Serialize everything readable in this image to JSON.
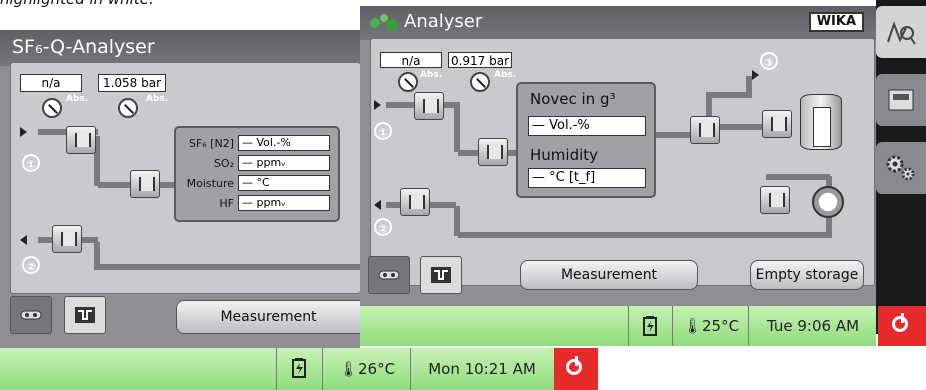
{
  "caption": "highlighted in white.",
  "back_window": {
    "title": "SF₆-Q-Analyser",
    "abs_label": "Abs.",
    "gauge1_value": "n/a",
    "gauge2_value": "1.058 bar",
    "marker1": "①",
    "marker2": "②",
    "readings": [
      {
        "label": "SF₆ [N2]",
        "value": "— Vol.-%"
      },
      {
        "label": "SO₂",
        "value": "— ppmᵥ"
      },
      {
        "label": "Moisture",
        "value": "— °C"
      },
      {
        "label": "HF",
        "value": "— ppmᵥ"
      }
    ],
    "measurement_button": "Measurement",
    "status": {
      "temperature": "26°C",
      "datetime": "Mon 10:21 AM"
    }
  },
  "front_window": {
    "title": "Analyser",
    "brand": "WIKA",
    "abs_label": "Abs.",
    "gauge1_value": "n/a",
    "gauge2_value": "0.917 bar",
    "marker1": "①",
    "marker2": "②",
    "marker3": "③",
    "novec_label": "Novec in g³",
    "novec_value": "— Vol.-%",
    "humidity_label": "Humidity",
    "humidity_value": "— °C [t_f]",
    "measurement_button": "Measurement",
    "empty_storage_button": "Empty storage",
    "status": {
      "temperature": "25°C",
      "datetime": "Tue 9:06 AM"
    }
  },
  "icons": {
    "view": "flow-view-icon",
    "map": "map-icon",
    "battery": "battery-icon",
    "thermometer": "thermometer-icon",
    "power": "power-icon",
    "analyse": "analyse-icon",
    "storage": "storage-tray-icon",
    "settings": "gears-icon"
  },
  "colors": {
    "status_green": "#9be089",
    "power_red": "#e72a2a",
    "window_gray": "#8e8f93",
    "panel_gray": "#c9cacd"
  }
}
